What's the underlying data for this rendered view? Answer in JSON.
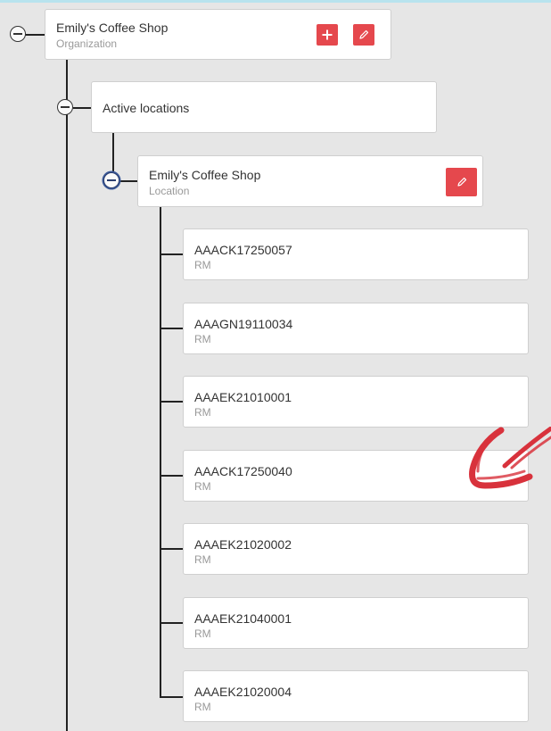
{
  "org": {
    "name": "Emily's Coffee Shop",
    "type": "Organization"
  },
  "group": {
    "label": "Active locations"
  },
  "location": {
    "name": "Emily's Coffee Shop",
    "type": "Location"
  },
  "devices": [
    {
      "id": "AAACK17250057",
      "type": "RM"
    },
    {
      "id": "AAAGN19110034",
      "type": "RM"
    },
    {
      "id": "AAAEK21010001",
      "type": "RM"
    },
    {
      "id": "AAACK17250040",
      "type": "RM"
    },
    {
      "id": "AAAEK21020002",
      "type": "RM"
    },
    {
      "id": "AAAEK21040001",
      "type": "RM"
    },
    {
      "id": "AAAEK21020004",
      "type": "RM"
    }
  ],
  "icons": {
    "add": "plus-icon",
    "edit": "pencil-icon",
    "collapse": "minus-circle-icon",
    "annotation": "red-arrow-annotation"
  },
  "colors": {
    "accent": "#e5484d",
    "background": "#e6e6e6",
    "annotation": "#d8323c"
  }
}
